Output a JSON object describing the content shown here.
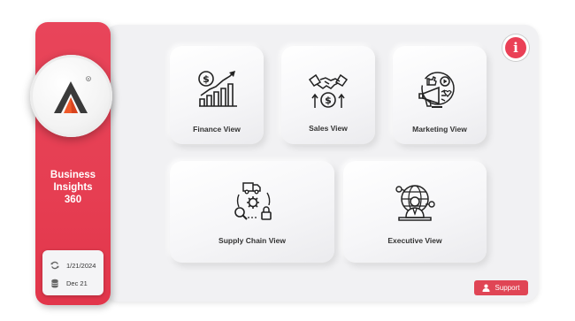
{
  "sidebar": {
    "brand_line1": "Business",
    "brand_line2": "Insights",
    "brand_line3": "360",
    "refresh_date": "1/21/2024",
    "data_date": "Dec 21",
    "accent_color": "#e63e52"
  },
  "cards": {
    "finance": {
      "label": "Finance View",
      "icon": "finance-growth-icon"
    },
    "sales": {
      "label": "Sales View",
      "icon": "handshake-money-icon"
    },
    "marketing": {
      "label": "Marketing View",
      "icon": "megaphone-social-icon"
    },
    "supply_chain": {
      "label": "Supply Chain View",
      "icon": "supply-chain-cycle-icon"
    },
    "executive": {
      "label": "Executive View",
      "icon": "executive-globe-icon"
    }
  },
  "info": {
    "symbol": "i"
  },
  "support": {
    "label": "Support"
  }
}
